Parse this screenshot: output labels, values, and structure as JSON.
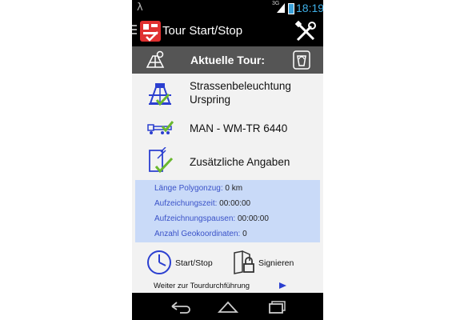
{
  "status_bar": {
    "left_glyph": "λ",
    "network": "3G",
    "time": "18:19"
  },
  "action_bar": {
    "title": "Tour Start/Stop",
    "icons": [
      "drawer-icon",
      "app-logo-icon",
      "tools-icon"
    ]
  },
  "tour_bar": {
    "title": "Aktuelle Tour:",
    "icons": [
      "tour-type-icon",
      "trash-icon"
    ]
  },
  "rows": [
    {
      "label_line1": "Strassenbeleuchtung",
      "label_line2": "Urspring",
      "icon": "road-sign-check-icon"
    },
    {
      "label_line1": "MAN - WM-TR 6440",
      "icon": "truck-check-icon"
    },
    {
      "label_line1": "Zusätzliche Angaben",
      "icon": "document-check-icon"
    }
  ],
  "info": {
    "length_label": "Länge Polygonzug:",
    "length_value": "0 km",
    "rec_time_label": "Aufzeichungszeit:",
    "rec_time_value": "00:00:00",
    "pause_label": "Aufzeichnungspausen:",
    "pause_value": "00:00:00",
    "coords_label": "Anzahl Geokoordinaten:",
    "coords_value": "0"
  },
  "actions": {
    "start_stop_label": "Start/Stop",
    "sign_label": "Signieren"
  },
  "continue": {
    "label": "Weiter zur Tourdurchführung"
  },
  "colors": {
    "accent_blue": "#3a52c8",
    "info_bg": "#c9daf8",
    "tour_bar_bg": "#555555",
    "check_green": "#6ab82e",
    "time_blue": "#3fb0e8"
  }
}
